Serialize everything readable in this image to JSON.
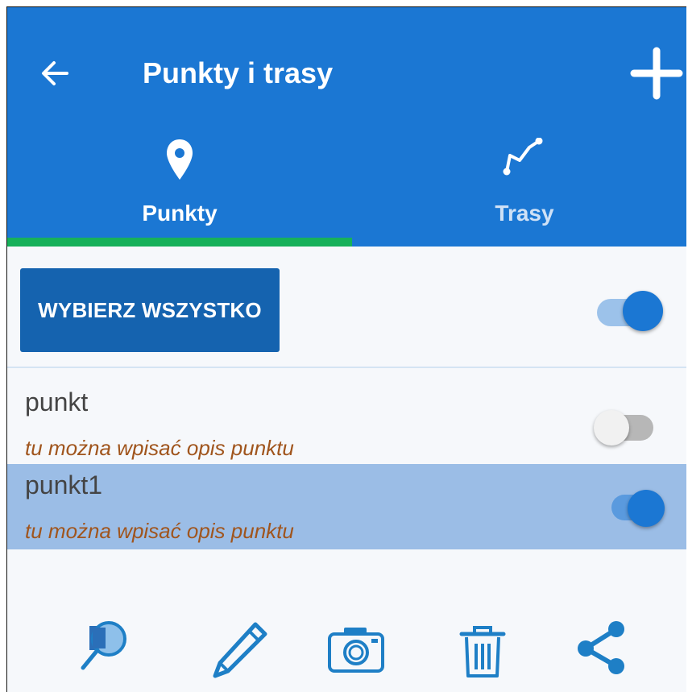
{
  "header": {
    "title": "Punkty i trasy"
  },
  "tabs": [
    {
      "label": "Punkty",
      "icon": "map-pin-icon",
      "active": true
    },
    {
      "label": "Trasy",
      "icon": "route-icon",
      "active": false
    }
  ],
  "select_all": {
    "label": "WYBIERZ WSZYSTKO",
    "toggle_on": true
  },
  "points": [
    {
      "name": "punkt",
      "description": "tu można wpisać opis punktu",
      "enabled": false,
      "selected": false
    },
    {
      "name": "punkt1",
      "description": "tu można wpisać opis punktu",
      "enabled": true,
      "selected": true
    }
  ],
  "toolbar": [
    {
      "icon": "search-map-icon"
    },
    {
      "icon": "edit-pencil-icon"
    },
    {
      "icon": "camera-icon"
    },
    {
      "icon": "trash-icon"
    },
    {
      "icon": "share-icon"
    }
  ],
  "colors": {
    "primary": "#1b77d3",
    "tab_indicator": "#17b15a",
    "selected_row": "#9bbde6",
    "description_text": "#a0551d",
    "button_dark": "#1563af",
    "icon_blue": "#1e7fc6"
  }
}
